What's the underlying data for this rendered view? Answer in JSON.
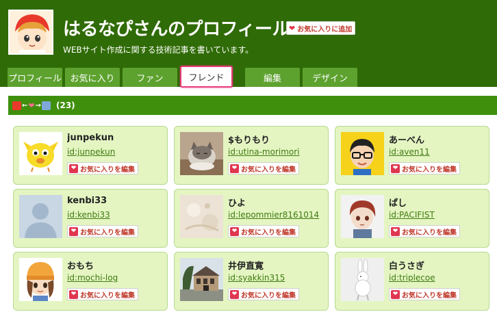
{
  "header": {
    "title": "はるなぴさんのプロフィール",
    "subtitle": "WEBサイト作成に関する技術記事を書いています。",
    "fav_add_label": "お気に入りに追加"
  },
  "tabs": [
    {
      "label": "プロフィール"
    },
    {
      "label": "お気に入り"
    },
    {
      "label": "ファン"
    },
    {
      "label": "フレンド",
      "active": true
    },
    {
      "label": "編集"
    },
    {
      "label": "デザイン"
    }
  ],
  "friends_bar": {
    "count": "(23)"
  },
  "edit_label": "お気に入りを編集",
  "friends": [
    {
      "name": "junpekun",
      "id": "id:junpekun",
      "icon": "yellow-bird-avatar"
    },
    {
      "name": "$もりもり",
      "id": "id:utina-morimori",
      "icon": "cat-photo-avatar"
    },
    {
      "name": "あーべん",
      "id": "id:aven11",
      "icon": "glasses-man-avatar"
    },
    {
      "name": "kenbi33",
      "id": "id:kenbi33",
      "icon": "default-silhouette-avatar"
    },
    {
      "name": "ひよ",
      "id": "id:lepommier8161014",
      "icon": "pale-texture-avatar"
    },
    {
      "name": "ぱし",
      "id": "id:PACIFIST",
      "icon": "red-hair-figure-avatar"
    },
    {
      "name": "おもち",
      "id": "id:mochi-log",
      "icon": "beanie-girl-avatar"
    },
    {
      "name": "井伊直寛",
      "id": "id:syakkin315",
      "icon": "building-photo-avatar"
    },
    {
      "name": "白うさぎ",
      "id": "id:triplecoe",
      "icon": "white-rabbit-avatar"
    }
  ],
  "colors": {
    "header_bg": "#2f6b06",
    "tab_bg": "#5da22e",
    "active_tab_border": "#e83a7a",
    "card_bg": "#e4f5c2",
    "link": "#3f7a11"
  }
}
